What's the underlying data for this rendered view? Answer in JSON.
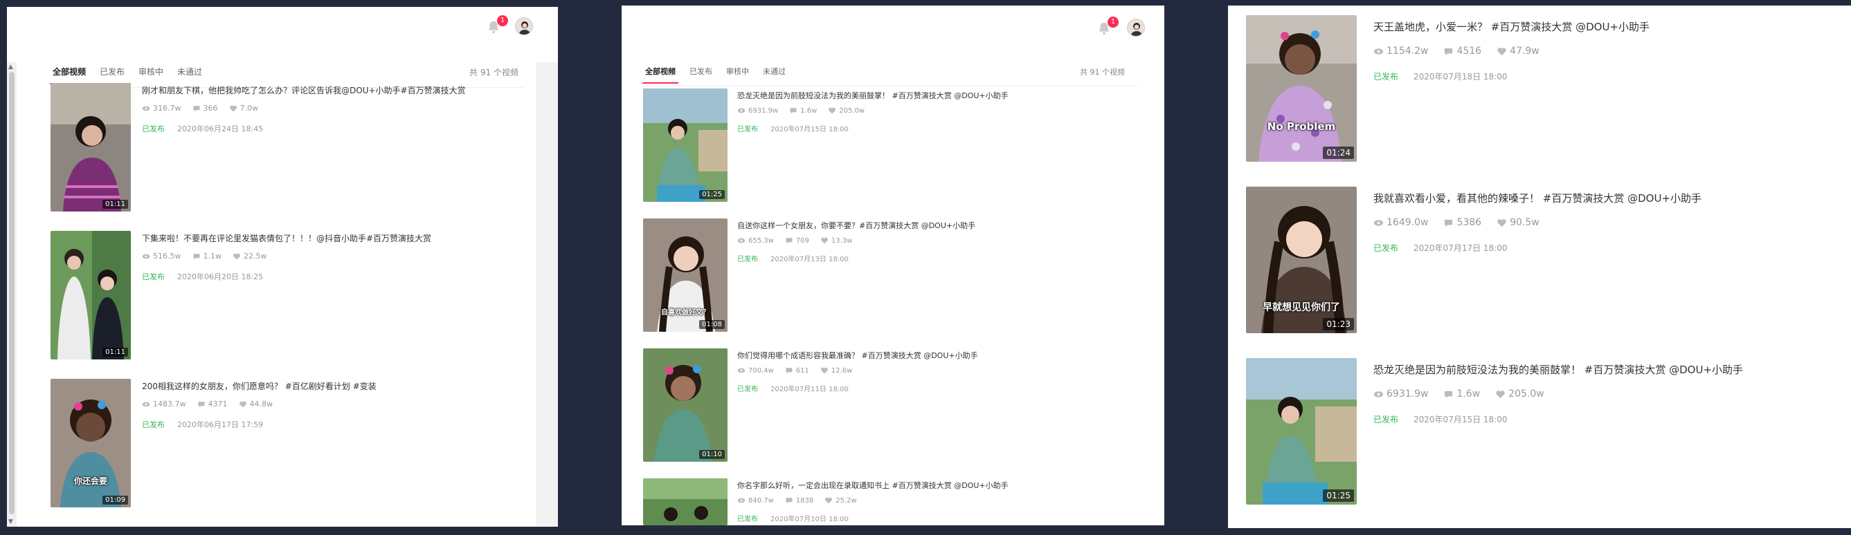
{
  "header": {
    "notification_count": "1"
  },
  "tabs": [
    "全部视频",
    "已发布",
    "审核中",
    "未通过"
  ],
  "total_label": "共 91 个视频",
  "colors": {
    "accent": "#fe2c55",
    "published": "#35b558",
    "background": "#232a3e"
  },
  "panel1": {
    "items": [
      {
        "title": "刚才和朋友下棋，他把我帅吃了怎么办？评论区告诉我@DOU+小助手#百万赞演技大赏",
        "views": "316.7w",
        "comments": "366",
        "likes": "7.0w",
        "status": "已发布",
        "date": "2020年06月24日 18:45",
        "duration": "01:11",
        "caption": ""
      },
      {
        "title": "下集来啦！不要再在评论里发猫表情包了！！！@抖音小助手#百万赞演技大赏",
        "views": "516.5w",
        "comments": "1.1w",
        "likes": "22.5w",
        "status": "已发布",
        "date": "2020年06月20日 18:25",
        "duration": "01:11",
        "caption": ""
      },
      {
        "title": "200相我这样的女朋友，你们愿意吗？ #百亿剧好看计划 #变装",
        "views": "1483.7w",
        "comments": "4371",
        "likes": "44.8w",
        "status": "已发布",
        "date": "2020年06月17日 17:59",
        "duration": "01:09",
        "caption": "你还会要"
      }
    ]
  },
  "panel2": {
    "items": [
      {
        "title": "恐龙灭绝是因为前肢短没法为我的美丽鼓掌！ #百万赞演技大赏 @DOU+小助手",
        "views": "6931.9w",
        "comments": "1.6w",
        "likes": "205.0w",
        "status": "已发布",
        "date": "2020年07月15日 18:00",
        "duration": "01:25",
        "caption": ""
      },
      {
        "title": "自送你这样一个女朋友，你要不要？#百万赞演技大赏 @DOU+小助手",
        "views": "655.3w",
        "comments": "709",
        "likes": "13.3w",
        "status": "已发布",
        "date": "2020年07月13日 18:00",
        "duration": "01:08",
        "caption": "自喜欢做好文？"
      },
      {
        "title": "你们觉得用哪个成语形容我最准确？ #百万赞演技大赏 @DOU+小助手",
        "views": "700.4w",
        "comments": "611",
        "likes": "12.6w",
        "status": "已发布",
        "date": "2020年07月11日 18:00",
        "duration": "01:10",
        "caption": ""
      },
      {
        "title": "你名字那么好听，一定会出现在录取通知书上 #百万赞演技大赏 @DOU+小助手",
        "views": "840.7w",
        "comments": "1838",
        "likes": "25.2w",
        "status": "已发布",
        "date": "2020年07月10日 18:00",
        "duration": "",
        "caption": ""
      }
    ]
  },
  "panel3": {
    "items": [
      {
        "title": "天王盖地虎，小爱一米？ #百万赞演技大赏 @DOU+小助手",
        "views": "1154.2w",
        "comments": "4516",
        "likes": "47.9w",
        "status": "已发布",
        "date": "2020年07月18日 18:00",
        "duration": "01:24",
        "caption": "No Problem"
      },
      {
        "title": "我就喜欢看小爱，看其他的辣嗓子！ #百万赞演技大赏 @DOU+小助手",
        "views": "1649.0w",
        "comments": "5386",
        "likes": "90.5w",
        "status": "已发布",
        "date": "2020年07月17日 18:00",
        "duration": "01:23",
        "caption": "早就想见见你们了"
      },
      {
        "title": "恐龙灭绝是因为前肢短没法为我的美丽鼓掌！ #百万赞演技大赏 @DOU+小助手",
        "views": "6931.9w",
        "comments": "1.6w",
        "likes": "205.0w",
        "status": "已发布",
        "date": "2020年07月15日 18:00",
        "duration": "01:25",
        "caption": ""
      }
    ]
  }
}
